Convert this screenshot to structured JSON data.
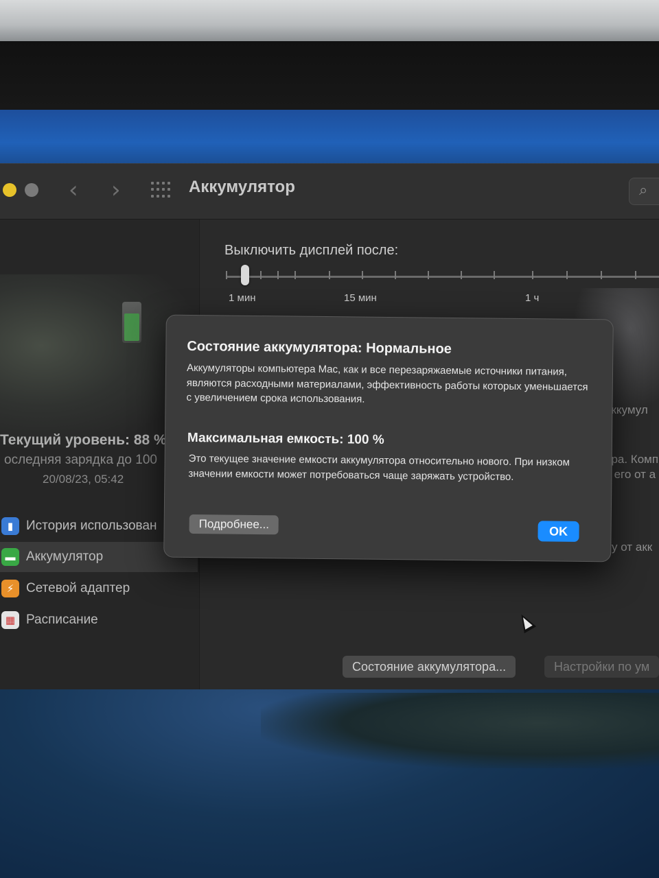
{
  "window": {
    "title": "Аккумулятор",
    "nav_back_icon": "chevron-left-icon",
    "nav_forward_icon": "chevron-right-icon",
    "search_icon": "search-icon"
  },
  "sidebar": {
    "current_level": "Текущий уровень: 88 %",
    "last_charge": "оследняя зарядка до 100",
    "last_charge_date": "20/08/23, 05:42",
    "items": [
      {
        "label": "История использован",
        "icon": "usage-history-icon",
        "color": "#3a7bd5",
        "active": false
      },
      {
        "label": "Аккумулятор",
        "icon": "battery-icon",
        "color": "#39a845",
        "active": true
      },
      {
        "label": "Сетевой адаптер",
        "icon": "bolt-icon",
        "color": "#e8902a",
        "active": false
      },
      {
        "label": "Расписание",
        "icon": "calendar-icon",
        "color": "#e5e5e5",
        "active": false
      }
    ]
  },
  "content": {
    "slider_label": "Выключить дисплей после:",
    "slider_ticks": [
      "1 мин",
      "15 мин",
      "1 ч"
    ],
    "fragments": [
      "а",
      "аккумул",
      "ора. Комп",
      "ь его от а",
      "оту от акк"
    ],
    "battery_health_button": "Состояние аккумулятора...",
    "defaults_button": "Настройки по ум"
  },
  "dialog": {
    "title": "Состояние аккумулятора: Нормальное",
    "body": "Аккумуляторы компьютера Mac, как и все перезаряжаемые источники питания, являются расходными материалами, эффективность работы которых уменьшается с увеличением срока использования.",
    "subtitle": "Максимальная емкость: 100 %",
    "body2": "Это текущее значение емкости аккумулятора относительно нового. При низком значении емкости может потребоваться чаще заряжать устройство.",
    "more_button": "Подробнее...",
    "ok_button": "OK",
    "accent": "#1a8cff"
  }
}
